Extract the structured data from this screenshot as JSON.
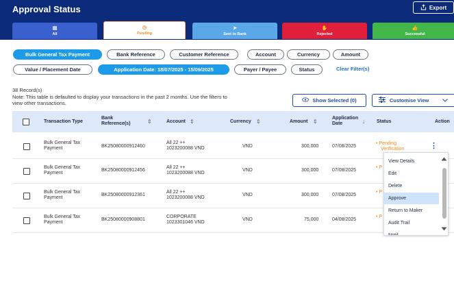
{
  "header": {
    "title": "Approval Status",
    "export_label": "Export"
  },
  "tabs": [
    {
      "label": "All",
      "icon": "inbox-icon"
    },
    {
      "label": "Pending",
      "icon": "clock-icon"
    },
    {
      "label": "Sent to Bank",
      "icon": "send-icon"
    },
    {
      "label": "Rejected",
      "icon": "hand-icon"
    },
    {
      "label": "Successful",
      "icon": "thumbs-up-icon"
    }
  ],
  "filters": {
    "chips": [
      "Bulk General Tax Payment",
      "Bank Reference",
      "Customer Reference",
      "Account",
      "Currency",
      "Amount",
      "Value / Placement Date",
      "Application Date: 18/07/2025 - 15/09/2025",
      "Payer / Payee",
      "Status"
    ],
    "clear_label": "Clear Filter(s)"
  },
  "records": {
    "count_label": "38 Record(s)",
    "note": "Note: This table is defaulted to display your transactions in the past 2 months. Use the filters to view other transactions."
  },
  "toolbar": {
    "show_selected_label": "Show Selected (0)",
    "customise_label": "Customise View"
  },
  "table": {
    "headers": {
      "transaction_type": "Transaction Type",
      "bank_ref_1": "Bank",
      "bank_ref_2": "Reference(s)",
      "account": "Account",
      "currency": "Currency",
      "amount": "Amount",
      "app_date_1": "Application",
      "app_date_2": "Date",
      "status": "Status",
      "action": "Action"
    },
    "rows": [
      {
        "type_1": "Bulk General Tax",
        "type_2": "Payment",
        "bank_ref": "BK25080000912460",
        "account_1": "All 22 ++",
        "account_2": "1023200088 VND",
        "currency": "VND",
        "amount": "300,000",
        "app_date": "07/08/2025",
        "status_1": "Pending",
        "status_2": "Verification"
      },
      {
        "type_1": "Bulk General Tax",
        "type_2": "Payment",
        "bank_ref": "BK25080000912456",
        "account_1": "All 22 ++",
        "account_2": "1023200088 VND",
        "currency": "VND",
        "amount": "300,000",
        "app_date": "07/08/2025",
        "status_1": "P",
        "status_2": ""
      },
      {
        "type_1": "Bulk General Tax",
        "type_2": "Payment",
        "bank_ref": "BK25080000912361",
        "account_1": "All 22 ++",
        "account_2": "1023200088 VND",
        "currency": "VND",
        "amount": "300,000",
        "app_date": "07/08/2025",
        "status_1": "P",
        "status_2": ""
      },
      {
        "type_1": "Bulk General Tax",
        "type_2": "Payment",
        "bank_ref": "BK25080000908801",
        "account_1": "CORPORATE",
        "account_2": "1023301046 VND",
        "currency": "VND",
        "amount": "75,000",
        "app_date": "04/08/2025",
        "status_1": "P",
        "status_2": ""
      }
    ]
  },
  "action_menu": {
    "items": [
      "View Details",
      "Edit",
      "Delete",
      "Approve",
      "Return to Maker",
      "Audit Trail",
      "Notif..."
    ],
    "highlighted": "Approve"
  },
  "colors": {
    "header_bg": "#0c2a7a",
    "accent_blue": "#1e9be8",
    "pending_orange": "#f08a1c",
    "rejected_red": "#e0203a",
    "successful_green": "#43b649"
  }
}
